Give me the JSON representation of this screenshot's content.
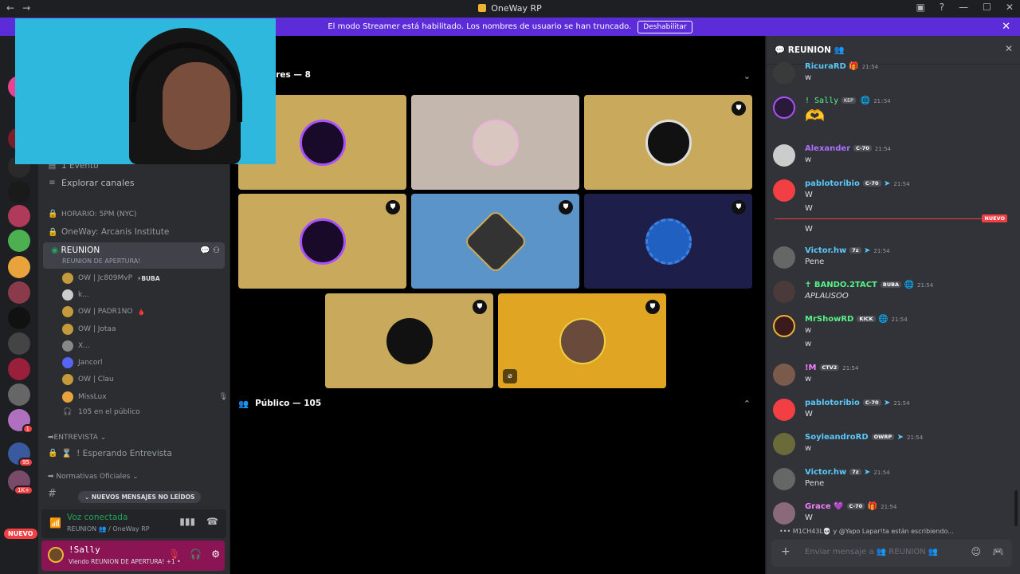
{
  "window": {
    "title": "OneWay RP",
    "back": "←",
    "forward": "→",
    "controls": [
      "▣",
      "?",
      "—",
      "☐",
      "✕"
    ]
  },
  "banner": {
    "text": "El modo Streamer está habilitado. Los nombres de usuario se han truncado.",
    "button": "Deshabilitar",
    "close": "✕"
  },
  "servers": {
    "nuevo_label": "NUEVO",
    "badges": [
      "1",
      "95",
      "1K+"
    ]
  },
  "sidebar": {
    "event": "1 Evento",
    "explore": "Explorar canales",
    "horario": "HORARIO: 5PM (NYC)",
    "institute": "OneWay: Arcanis Institute",
    "active_channel": {
      "name": "REUNION",
      "sub": "REUNION DE APERTURA!"
    },
    "voice_users": [
      {
        "name": "OW | Jc809MvP",
        "tag": "⚡BUBA"
      },
      {
        "name": "k...",
        "tag": ""
      },
      {
        "name": "OW | PADR1NO",
        "tag": "🩸"
      },
      {
        "name": "OW | Jotaa",
        "tag": ""
      },
      {
        "name": "X...",
        "tag": ""
      },
      {
        "name": "Jancorl",
        "tag": ""
      },
      {
        "name": "OW | Clau",
        "tag": ""
      },
      {
        "name": "MissLux",
        "tag": ""
      }
    ],
    "audience": "105 en el público",
    "section_entrevista": "➡ENTREVISTA",
    "esperando": "! Esperando Entrevista",
    "section_normativas": "➡ Normativas Oficiales",
    "unread_pill": "NUEVOS MENSAJES NO LEÍDOS"
  },
  "voicebar": {
    "state": "Voz conectada",
    "where": "REUNION 👥 / OneWay RP"
  },
  "userbar": {
    "name": "!Sally",
    "status": "Viendo REUNION DE APERTURA! +1 •"
  },
  "stage": {
    "speakers_header": "ores — 8",
    "public_header": "Público — 105"
  },
  "chat": {
    "channel": "REUNION 👥",
    "new_label": "NUEVO",
    "messages": [
      {
        "name": "RicuraRD",
        "tag": "",
        "time": "21:54",
        "lines": [
          "w"
        ],
        "color": "#5ac8fa"
      },
      {
        "name": "! Sally",
        "tag": "KEP",
        "time": "21:54",
        "lines": [
          "🫶"
        ],
        "color": "#57f287"
      },
      {
        "name": "Alexander",
        "tag": "C-70",
        "time": "21:54",
        "lines": [
          "w"
        ],
        "color": "#a970ff"
      },
      {
        "name": "pablotoribio",
        "tag": "C-70",
        "time": "21:54",
        "lines": [
          "W",
          "W"
        ],
        "color": "#5ac8fa"
      },
      {
        "name": "",
        "tag": "",
        "time": "",
        "lines": [
          "W"
        ],
        "color": "#dbdee1"
      },
      {
        "name": "Victor.hw",
        "tag": "7z",
        "time": "21:54",
        "lines": [
          "Pene"
        ],
        "color": "#5ac8fa"
      },
      {
        "name": "✝ BANDO.2TACT",
        "tag": "BUBA",
        "time": "21:54",
        "lines": [
          "APLAUSOO"
        ],
        "color": "#57f287"
      },
      {
        "name": "MrShowRD",
        "tag": "KICK",
        "time": "21:54",
        "lines": [
          "w",
          "w"
        ],
        "color": "#57f287"
      },
      {
        "name": "!M",
        "tag": "CTV2",
        "time": "21:54",
        "lines": [
          "w"
        ],
        "color": "#f47fff"
      },
      {
        "name": "pablotoribio",
        "tag": "C-70",
        "time": "21:54",
        "lines": [
          "W"
        ],
        "color": "#5ac8fa"
      },
      {
        "name": "SoyleandroRD",
        "tag": "OWRP",
        "time": "21:54",
        "lines": [
          "w"
        ],
        "color": "#5ac8fa"
      },
      {
        "name": "Victor.hw",
        "tag": "7z",
        "time": "21:54",
        "lines": [
          "Pene"
        ],
        "color": "#5ac8fa"
      },
      {
        "name": "Grace",
        "tag": "C-70",
        "time": "21:54",
        "lines": [
          "W"
        ],
        "color": "#f47fff"
      }
    ],
    "typing": "M1CH43L💀 y @Yapo Lapar!ta están escribiendo...",
    "placeholder": "Enviar mensaje a 👥 REUNION 👥"
  }
}
